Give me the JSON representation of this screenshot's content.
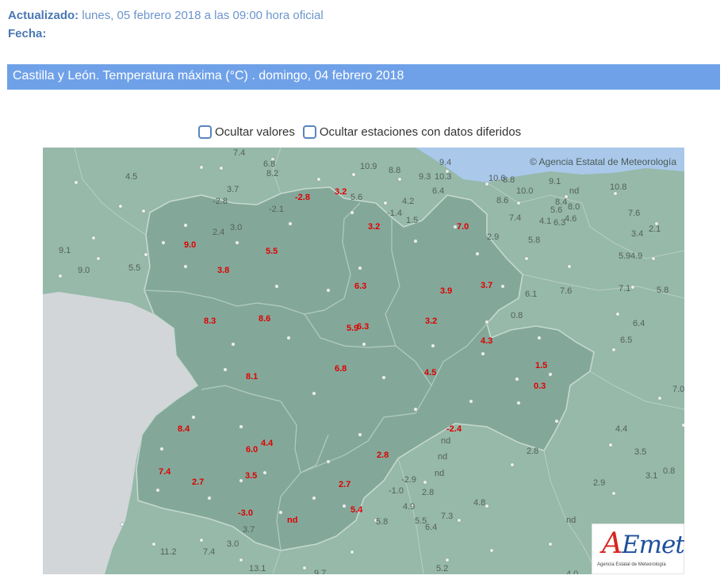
{
  "meta": {
    "updated_label": "Actualizado:",
    "updated_value": "lunes, 05 febrero 2018 a las 09:00 hora oficial",
    "date_label": "Fecha:"
  },
  "header": {
    "title": "Castilla y León. Temperatura máxima (°C) . domingo, 04 febrero 2018"
  },
  "options": {
    "hide_values": "Ocultar valores",
    "hide_stations": "Ocultar estaciones con datos diferidos"
  },
  "map": {
    "copyright": "© Agencia Estatal de Meteorología",
    "logo_text": "AEmet",
    "logo_subtitle": "Agencia Estatal de Meteorología",
    "colors": {
      "sea": "#a9c8ea",
      "land": "#96b9a9",
      "region": "#83a89a",
      "portugal": "#d2d6d9",
      "value_inside": "#e00000",
      "value_outside": "#555f5c"
    },
    "labels_outside": [
      "7.4",
      "6.8",
      "8.2",
      "4.5",
      "10.9",
      "8.8",
      "9.4",
      "9.3",
      "10.3",
      "10.6",
      "8.8",
      "9.1",
      "6.4",
      "10.0",
      "nd",
      "10.8",
      "3.7",
      "-2.8",
      "5.6",
      "8.6",
      "4.2",
      "8.4",
      "8.0",
      "5.6",
      "-2.1",
      "-1.4",
      "7.6",
      "4.6",
      "4.1",
      "7.4",
      "1.5",
      "6.3",
      "3.4",
      "2.1",
      "3.0",
      "2.4",
      "2.9",
      "5.8",
      "9.1",
      "5.9",
      "4.9",
      "9.0",
      "5.5",
      "7.1",
      "5.8",
      "7.6",
      "6.1",
      "6.4",
      "0.8",
      "6.5",
      "7.0",
      "nd",
      "nd",
      "4.4",
      "nd",
      "2.8",
      "3.5",
      "0.8",
      "3.1",
      "-2.9",
      "2.9",
      "2.8",
      "-1.0",
      "4.9",
      "4.8",
      "7.3",
      "5.5",
      "6.4",
      "5.8",
      "nd",
      "3.7",
      "3.0",
      "11.2",
      "7.4",
      "13.1",
      "9.7",
      "5.2",
      "4.0"
    ],
    "labels_inside": [
      "-2.8",
      "3.2",
      "9.0",
      "5.5",
      "3.2",
      "7.0",
      "3.8",
      "6.3",
      "3.9",
      "3.7",
      "8.3",
      "8.6",
      "5.9",
      "6.3",
      "3.2",
      "4.3",
      "1.5",
      "8.1",
      "6.8",
      "4.5",
      "0.3",
      "8.4",
      "-2.4",
      "6.0",
      "4.4",
      "2.8",
      "7.4",
      "2.7",
      "3.5",
      "2.7",
      "-3.0",
      "5.4",
      "nd"
    ]
  }
}
